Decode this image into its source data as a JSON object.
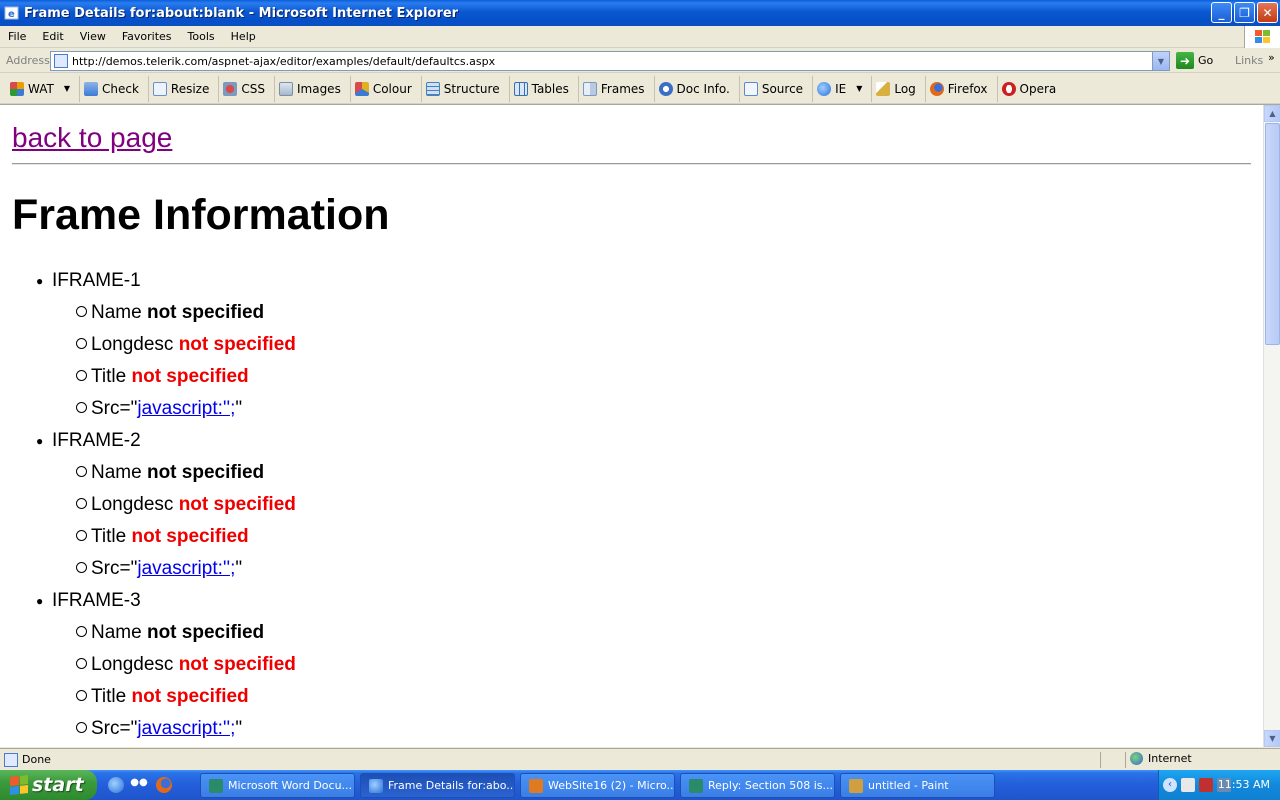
{
  "window": {
    "title": "Frame Details for:about:blank - Microsoft Internet Explorer",
    "minimize": "_",
    "maximize": "❐",
    "close": "✕"
  },
  "menu": [
    "File",
    "Edit",
    "View",
    "Favorites",
    "Tools",
    "Help"
  ],
  "address": {
    "label": "Address",
    "url": "http://demos.telerik.com/aspnet-ajax/editor/examples/default/defaultcs.aspx",
    "go_label": "Go",
    "links_label": "Links"
  },
  "toolbar": [
    {
      "label": "WAT",
      "icon": "wat-icon",
      "color": "#e8a000",
      "dropdown": true
    },
    {
      "label": "Check",
      "icon": "check-icon",
      "color": "#3b7bd6"
    },
    {
      "label": "Resize",
      "icon": "resize-icon",
      "color": "#6b8fc9"
    },
    {
      "label": "CSS",
      "icon": "css-icon",
      "color": "#d94a4a"
    },
    {
      "label": "Images",
      "icon": "images-icon",
      "color": "#7d8fa6"
    },
    {
      "label": "Colour",
      "icon": "colour-icon",
      "color": "#e0b020"
    },
    {
      "label": "Structure",
      "icon": "structure-icon",
      "color": "#4a7fb8"
    },
    {
      "label": "Tables",
      "icon": "tables-icon",
      "color": "#3a6fb0"
    },
    {
      "label": "Frames",
      "icon": "frames-icon",
      "color": "#7a9ac0"
    },
    {
      "label": "Doc Info.",
      "icon": "doc-info-icon",
      "color": "#3b6fc6"
    },
    {
      "label": "Source",
      "icon": "source-icon",
      "color": "#5a8ad0"
    },
    {
      "label": "IE",
      "icon": "ie-icon",
      "color": "#2a6fd8",
      "dropdown": true
    },
    {
      "label": "Log",
      "icon": "log-icon",
      "color": "#d8b040"
    },
    {
      "label": "Firefox",
      "icon": "firefox-icon",
      "color": "#e06a1a"
    },
    {
      "label": "Opera",
      "icon": "opera-icon",
      "color": "#cc1f1f"
    }
  ],
  "page": {
    "back_link": "back to page",
    "heading": "Frame Information",
    "frames": [
      {
        "name": "IFRAME-1",
        "name_label": "Name",
        "name_value": "not specified",
        "longdesc_label": "Longdesc",
        "longdesc_value": "not specified",
        "title_label": "Title",
        "title_value": "not specified",
        "src_prefix": "Src=\"",
        "src_value": "javascript:'';",
        "src_suffix": "\""
      },
      {
        "name": "IFRAME-2",
        "name_label": "Name",
        "name_value": "not specified",
        "longdesc_label": "Longdesc",
        "longdesc_value": "not specified",
        "title_label": "Title",
        "title_value": "not specified",
        "src_prefix": "Src=\"",
        "src_value": "javascript:'';",
        "src_suffix": "\""
      },
      {
        "name": "IFRAME-3",
        "name_label": "Name",
        "name_value": "not specified",
        "longdesc_label": "Longdesc",
        "longdesc_value": "not specified",
        "title_label": "Title",
        "title_value": "not specified",
        "src_prefix": "Src=\"",
        "src_value": "javascript:'';",
        "src_suffix": "\""
      }
    ]
  },
  "status": {
    "text": "Done",
    "zone": "Internet"
  },
  "taskbar": {
    "start_label": "start",
    "buttons": [
      {
        "label": "Microsoft Word Docu...",
        "icon": "word-icon",
        "color": "#2b579a"
      },
      {
        "label": "Frame Details for:abo...",
        "icon": "ie-icon",
        "color": "#2a6fd8",
        "active": true
      },
      {
        "label": "WebSite16 (2) - Micro...",
        "icon": "visual-studio-icon",
        "color": "#e07a20"
      },
      {
        "label": "Reply: Section 508 is...",
        "icon": "mail-icon",
        "color": "#2a8a6a"
      },
      {
        "label": "untitled - Paint",
        "icon": "paint-icon",
        "color": "#d0a040"
      }
    ],
    "clock": "11:53 AM"
  }
}
